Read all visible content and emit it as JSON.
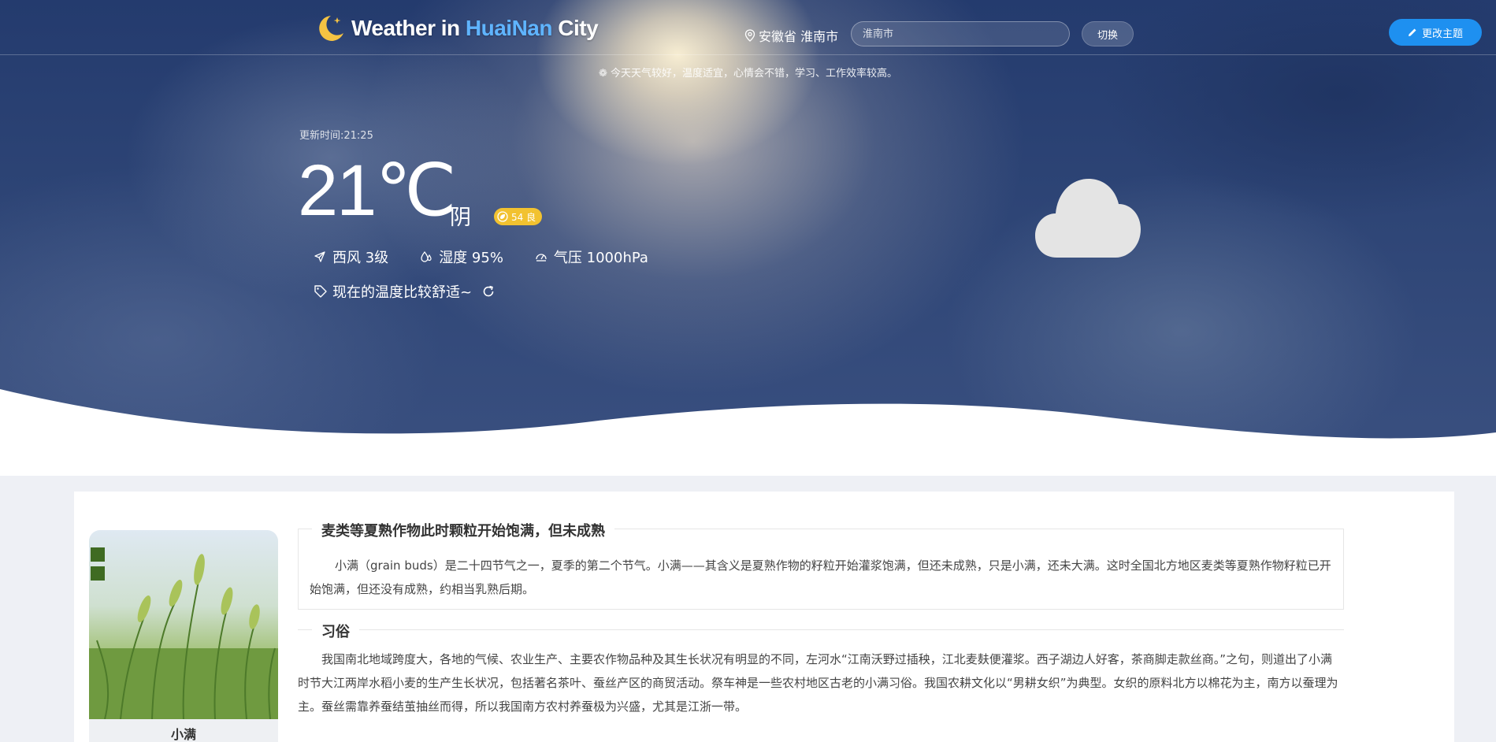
{
  "header": {
    "brand_prefix": "Weather in ",
    "brand_city": "HuaiNan",
    "brand_suffix": " City",
    "location": "安徽省 淮南市",
    "search_value": "",
    "search_placeholder": "淮南市",
    "switch_label": "切换",
    "theme_label": "更改主题",
    "tip": "今天天气较好，温度适宜，心情会不错，学习、工作效率较高。"
  },
  "weather": {
    "update_time": "更新时间:21:25",
    "temperature": "21℃",
    "condition": "阴",
    "aqi": "54 良",
    "wind": "西风 3级",
    "humidity": "湿度 95%",
    "pressure": "气压 1000hPa",
    "comfort": "现在的温度比较舒适~",
    "aqi_color": "#f2c230",
    "weather_icon": "cloud-icon"
  },
  "solar_term": {
    "name": "小满",
    "title1": "麦类等夏熟作物此时颗粒开始饱满，但未成熟",
    "para1": "小满（grain buds）是二十四节气之一，夏季的第二个节气。小满——其含义是夏熟作物的籽粒开始灌浆饱满，但还未成熟，只是小满，还未大满。这时全国北方地区麦类等夏熟作物籽粒已开始饱满，但还没有成熟，约相当乳熟后期。",
    "title2": "习俗",
    "para2": "我国南北地域跨度大，各地的气候、农业生产、主要农作物品种及其生长状况有明显的不同，左河水“江南沃野过插秧，江北麦麸便灌浆。西子湖边人好客，茶商脚走款丝商。”之句，则道出了小满时节大江两岸水稻小麦的生产生长状况，包括著名茶叶、蚕丝产区的商贸活动。祭车神是一些农村地区古老的小满习俗。我国农耕文化以“男耕女织”为典型。女织的原料北方以棉花为主，南方以蚕理为主。蚕丝需靠养蚕结茧抽丝而得，所以我国南方农村养蚕极为兴盛，尤其是江浙一带。"
  },
  "colors": {
    "accent": "#1e90f0",
    "brand_city": "#5fb4ff"
  }
}
